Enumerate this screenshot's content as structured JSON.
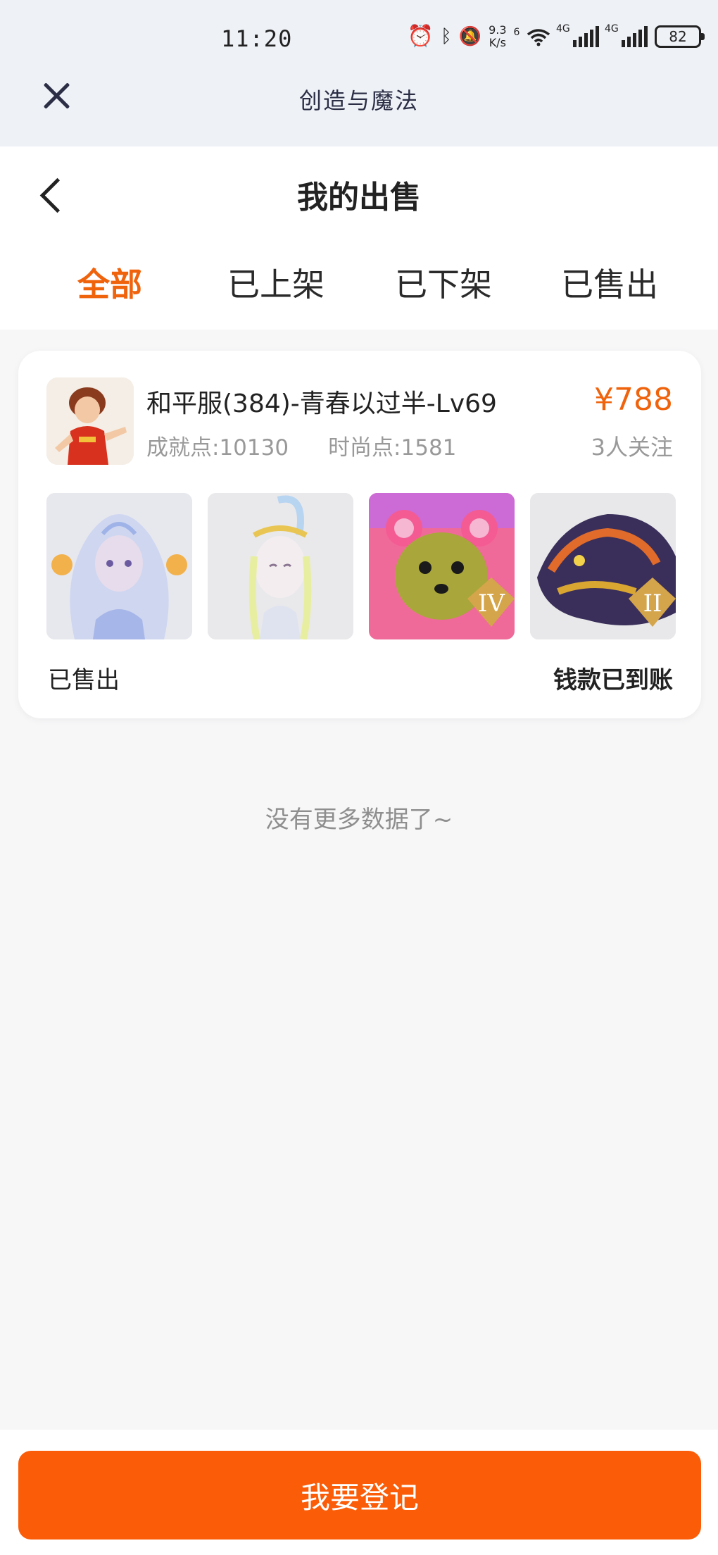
{
  "status_bar": {
    "time": "11:20",
    "net_speed_value": "9.3",
    "net_speed_unit": "K/s",
    "wifi_tag": "6",
    "signal1_tag": "4G",
    "signal2_tag": "4G",
    "battery": "82",
    "icons": [
      "alarm-icon",
      "bluetooth-icon",
      "mute-icon",
      "wifi-icon",
      "signal-icon",
      "battery-icon"
    ]
  },
  "webview": {
    "title": "创造与魔法",
    "close_icon": "close-icon"
  },
  "header": {
    "title": "我的出售",
    "back_icon": "chevron-left-icon"
  },
  "tabs": [
    {
      "label": "全部",
      "active": true
    },
    {
      "label": "已上架",
      "active": false
    },
    {
      "label": "已下架",
      "active": false
    },
    {
      "label": "已售出",
      "active": false
    }
  ],
  "listing": {
    "name": "和平服(384)-青春以过半-Lv69",
    "price": "¥788",
    "achievement": "成就点:10130",
    "fashion": "时尚点:1581",
    "followers": "3人关注",
    "thumb_badges": [
      "",
      "",
      "IV",
      "II"
    ],
    "status": "已售出",
    "payment_status": "钱款已到账"
  },
  "footer_note": "没有更多数据了~",
  "register_button": "我要登记",
  "colors": {
    "accent": "#f0630d",
    "button": "#fb5c08"
  }
}
